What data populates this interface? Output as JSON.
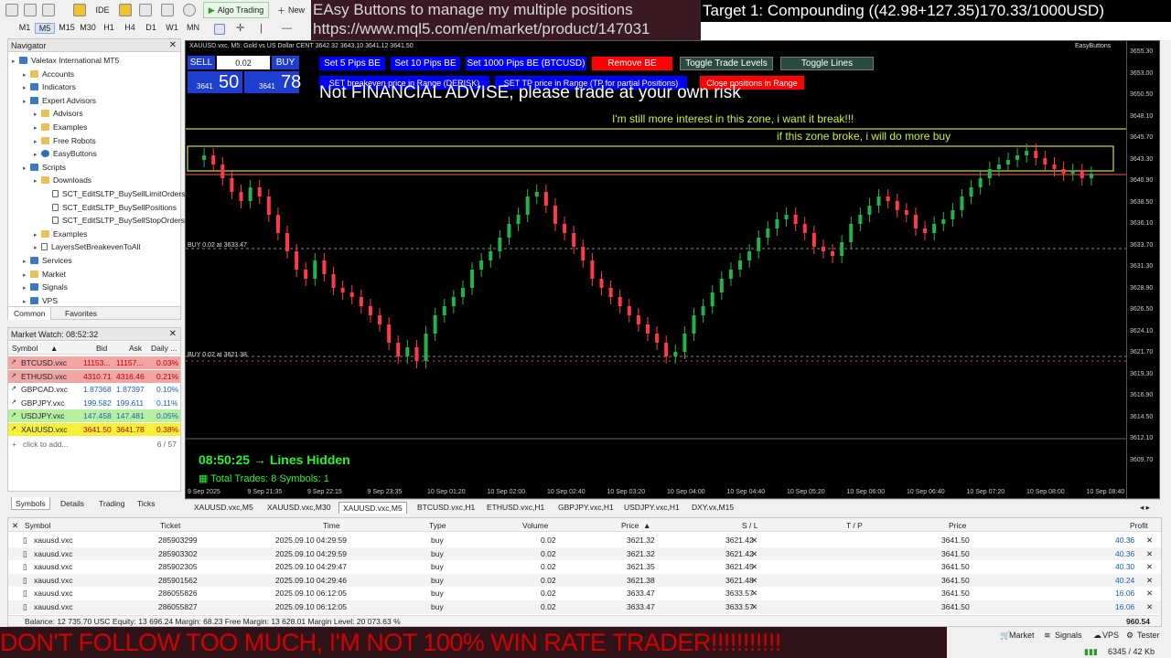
{
  "toolbar": {
    "timeframes": [
      "M1",
      "M5",
      "M15",
      "M30",
      "H1",
      "H4",
      "D1",
      "W1",
      "MN"
    ],
    "active_timeframe": "M5",
    "ide": "IDE",
    "algo_trading": "Algo Trading",
    "new": "New"
  },
  "overlay": {
    "promo_line1": "EAsy Buttons to manage my multiple positions",
    "promo_line2": "https://www.mql5.com/en/market/product/147031",
    "target": "Target 1: Compounding ((42.98+127.35)170.33/1000USD)",
    "bottom_banner": "DON'T FOLLOW TOO MUCH, I'M NOT 100% WIN RATE TRADER!!!!!!!!!!!"
  },
  "navigator": {
    "title": "Navigator",
    "items": [
      {
        "label": "Valetax International MT5",
        "indent": 0,
        "icon": "broker-icon"
      },
      {
        "label": "Accounts",
        "indent": 1,
        "icon": "accounts-icon"
      },
      {
        "label": "Indicators",
        "indent": 1,
        "icon": "indicators-icon"
      },
      {
        "label": "Expert Advisors",
        "indent": 1,
        "icon": "expert-icon"
      },
      {
        "label": "Advisors",
        "indent": 2,
        "icon": "folder-icon"
      },
      {
        "label": "Examples",
        "indent": 2,
        "icon": "folder-icon"
      },
      {
        "label": "Free Robots",
        "indent": 2,
        "icon": "folder-icon"
      },
      {
        "label": "EasyButtons",
        "indent": 2,
        "icon": "robot-icon"
      },
      {
        "label": "Scripts",
        "indent": 1,
        "icon": "scripts-icon"
      },
      {
        "label": "Downloads",
        "indent": 2,
        "icon": "folder-icon"
      },
      {
        "label": "SCT_EditSLTP_BuySellLimitOrders",
        "indent": 3,
        "icon": "script-icon"
      },
      {
        "label": "SCT_EditSLTP_BuySellPositions",
        "indent": 3,
        "icon": "script-icon"
      },
      {
        "label": "SCT_EditSLTP_BuySellStopOrders",
        "indent": 3,
        "icon": "script-icon"
      },
      {
        "label": "Examples",
        "indent": 2,
        "icon": "folder-icon"
      },
      {
        "label": "LayersSetBreakevenToAll",
        "indent": 2,
        "icon": "script-icon"
      },
      {
        "label": "Services",
        "indent": 1,
        "icon": "services-icon"
      },
      {
        "label": "Market",
        "indent": 1,
        "icon": "market-icon"
      },
      {
        "label": "Signals",
        "indent": 1,
        "icon": "signals-icon"
      },
      {
        "label": "VPS",
        "indent": 1,
        "icon": "vps-icon"
      }
    ],
    "tabs": [
      "Common",
      "Favorites"
    ]
  },
  "market_watch": {
    "title": "Market Watch: 08:52:32",
    "columns": [
      "Symbol",
      "Bid",
      "Ask",
      "Daily ..."
    ],
    "rows": [
      {
        "symbol": "BTCUSD.vxc",
        "bid": "11153...",
        "ask": "11157...",
        "daily": "0.03%",
        "bg": "#f2a5a5",
        "color": "#c00000"
      },
      {
        "symbol": "ETHUSD.vxc",
        "bid": "4310.71",
        "ask": "4316.46",
        "daily": "0.21%",
        "bg": "#f2a5a5",
        "color": "#c00000"
      },
      {
        "symbol": "GBPCAD.vxc",
        "bid": "1.87368",
        "ask": "1.87397",
        "daily": "0.10%",
        "bg": "#ffffff",
        "color": "#1a5fc0"
      },
      {
        "symbol": "GBPJPY.vxc",
        "bid": "199.582",
        "ask": "199.611",
        "daily": "0.11%",
        "bg": "#ffffff",
        "color": "#1a5fc0"
      },
      {
        "symbol": "USDJPY.vxc",
        "bid": "147.458",
        "ask": "147.481",
        "daily": "0.05%",
        "bg": "#b7f0a0",
        "color": "#1a5fc0"
      },
      {
        "symbol": "XAUUSD.vxc",
        "bid": "3641.50",
        "ask": "3641.78",
        "daily": "0.38%",
        "bg": "#f5f03a",
        "color": "#c00000"
      }
    ],
    "add": "click to add...",
    "count": "6 / 57"
  },
  "chart": {
    "title": "XAUUSD.vxc, M5: Gold vs US Dollar CENT  3642.32 3643.10 3641.12 3641.50",
    "ea_name": "EasyButtons",
    "sell_label": "SELL",
    "buy_label": "BUY",
    "lot": "0.02",
    "bid_big": "50",
    "bid_small": "3641",
    "ask_big": "78",
    "ask_small": "3641",
    "buttons": {
      "set5": "Set 5 Pips BE",
      "set10": "Set 10 Pips BE",
      "set1000": "Set 1000 Pips BE (BTCUSD)",
      "remove": "Remove BE",
      "toggle_levels": "Toggle Trade Levels",
      "toggle_lines": "Toggle Lines",
      "derisk": "SET breakeven price in Range (DERISK)",
      "tp_range": "SET TP price in Range (TP for partial Positions)",
      "close_range": "Close positions in Range"
    },
    "notice": "Not FINANCIAL ADVISE, please trade at your own risk",
    "zone_note1": "I'm still more interest in this zone, i want it break!!!",
    "zone_note2": "if this zone broke, i will do more buy",
    "buy_line1": "BUY 0.02 at 3633.47",
    "buy_line2": "BUY 0.02 at 3621.38",
    "status_time": "08:50:25 → Lines Hidden",
    "status_trades": "Total Trades: 8 Symbols: 1",
    "price_ticks": [
      "3655.30",
      "3653.00",
      "3650.50",
      "3648.10",
      "3645.70",
      "3643.30",
      "3640.90",
      "3638.50",
      "3636.10",
      "3633.70",
      "3631.30",
      "3628.90",
      "3626.50",
      "3624.10",
      "3621.70",
      "3619.30",
      "3616.90",
      "3614.50",
      "3612.10",
      "3609.70"
    ],
    "time_ticks": [
      "9 Sep 2025",
      "9 Sep 21:35",
      "9 Sep 22:15",
      "9 Sep 23:35",
      "10 Sep 01:20",
      "10 Sep 02:00",
      "10 Sep 02:40",
      "10 Sep 03:20",
      "10 Sep 04:00",
      "10 Sep 04:40",
      "10 Sep 05:20",
      "10 Sep 06:00",
      "10 Sep 06:40",
      "10 Sep 07:20",
      "10 Sep 08:00",
      "10 Sep 08:40"
    ]
  },
  "chart_tabs": [
    "XAUUSD.vxc,M5",
    "XAUUSD.vxc,M30",
    "XAUUSD.vxc,M5",
    "BTCUSD.vxc,H1",
    "ETHUSD.vxc,H1",
    "GBPJPY.vxc,H1",
    "USDJPY.vxc,H1",
    "DXY.vx,M15"
  ],
  "left_tabs": [
    "Symbols",
    "Details",
    "Trading",
    "Ticks"
  ],
  "trade": {
    "columns": [
      "Symbol",
      "Ticket",
      "Time",
      "Type",
      "Volume",
      "Price",
      "S / L",
      "T / P",
      "Price",
      "Profit"
    ],
    "rows": [
      {
        "symbol": "xauusd.vxc",
        "ticket": "285903299",
        "time": "2025.09.10 04:29:59",
        "type": "buy",
        "volume": "0.02",
        "price": "3621.32",
        "sl": "3621.42",
        "tp": "",
        "cur": "3641.50",
        "profit": "40.36"
      },
      {
        "symbol": "xauusd.vxc",
        "ticket": "285903302",
        "time": "2025.09.10 04:29:59",
        "type": "buy",
        "volume": "0.02",
        "price": "3621.32",
        "sl": "3621.42",
        "tp": "",
        "cur": "3641.50",
        "profit": "40.36"
      },
      {
        "symbol": "xauusd.vxc",
        "ticket": "285902305",
        "time": "2025.09.10 04:29:47",
        "type": "buy",
        "volume": "0.02",
        "price": "3621.35",
        "sl": "3621.45",
        "tp": "",
        "cur": "3641.50",
        "profit": "40.30"
      },
      {
        "symbol": "xauusd.vxc",
        "ticket": "285901562",
        "time": "2025.09.10 04:29:46",
        "type": "buy",
        "volume": "0.02",
        "price": "3621.38",
        "sl": "3621.48",
        "tp": "",
        "cur": "3641.50",
        "profit": "40.24"
      },
      {
        "symbol": "xauusd.vxc",
        "ticket": "286055826",
        "time": "2025.09.10 06:12:05",
        "type": "buy",
        "volume": "0.02",
        "price": "3633.47",
        "sl": "3633.57",
        "tp": "",
        "cur": "3641.50",
        "profit": "16.06"
      },
      {
        "symbol": "xauusd.vxc",
        "ticket": "286055827",
        "time": "2025.09.10 06:12:05",
        "type": "buy",
        "volume": "0.02",
        "price": "3633.47",
        "sl": "3633.57",
        "tp": "",
        "cur": "3641.50",
        "profit": "16.06"
      }
    ],
    "balance": "Balance: 12 735.70 USC  Equity: 13 696.24  Margin: 68.23  Free Margin: 13 628.01  Margin Level: 20 073.63 %",
    "total": "960.54"
  },
  "status": {
    "market": "Market",
    "signals": "Signals",
    "vps": "VPS",
    "tester": "Tester",
    "net": "6345 / 42 Kb"
  },
  "colors": {
    "bull": "#22b34a",
    "bear": "#ff3b4b",
    "zone": "#ffff66",
    "btn_blue": "#0000ff",
    "btn_red": "#ff0000",
    "btn_dark": "#2b4b40"
  }
}
